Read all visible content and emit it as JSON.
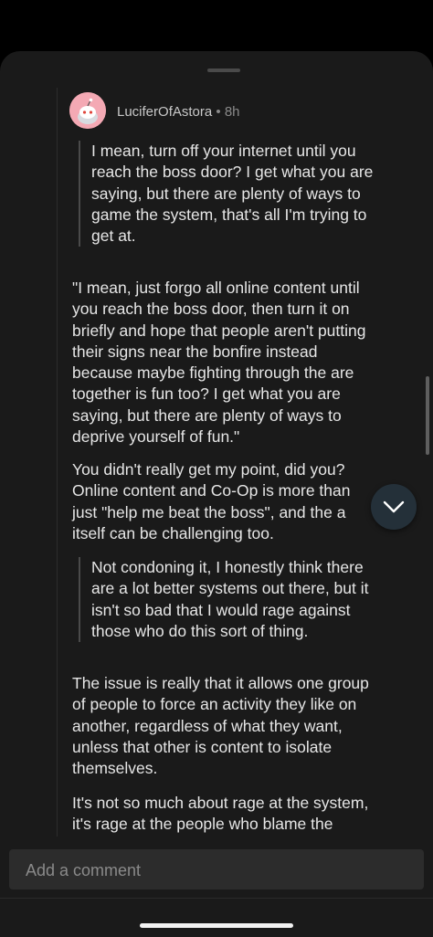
{
  "comment": {
    "username": "LuciferOfAstora",
    "separator": "•",
    "time_ago": "8h",
    "quote1_lines": [
      "I mean, turn off your internet until you",
      "reach the boss door? I get what you are",
      "saying, but there are plenty of ways to",
      "game the system, that's all I'm trying to",
      "get at."
    ],
    "para1_lines": [
      "\"I mean, just forgo all online content until",
      "you reach the boss door, then turn it on",
      "briefly and hope that people aren't putting",
      "their signs near the bonfire instead",
      "because maybe fighting through the are",
      "together is fun too? I get what you are",
      "saying, but there are plenty of ways to",
      "deprive yourself of fun.\""
    ],
    "para2_lines": [
      "You didn't really get my point, did you?",
      "Online content and Co-Op is more than",
      "just \"help me beat the boss\", and the a",
      "itself can be challenging too."
    ],
    "quote2_lines": [
      "Not condoning it, I honestly think there",
      "are a lot better systems out there, but it",
      "isn't so bad that I would rage against",
      "those who do this sort of thing."
    ],
    "para3_lines": [
      "The issue is really that it allows one group",
      "of people to force an activity they like on",
      "another, regardless of what they want,",
      "unless that other is content to isolate",
      "themselves."
    ],
    "para4_lines": [
      "It's not so much about rage at the system,",
      "it's rage at the people who blame the"
    ]
  },
  "composer": {
    "placeholder": "Add a comment"
  },
  "icons": {
    "avatar": "snoo-avatar",
    "scroll": "chevron-down-icon"
  },
  "colors": {
    "background": "#1a1a1a",
    "avatar_bg": "#f4a9b4",
    "fab_bg": "#243039"
  }
}
